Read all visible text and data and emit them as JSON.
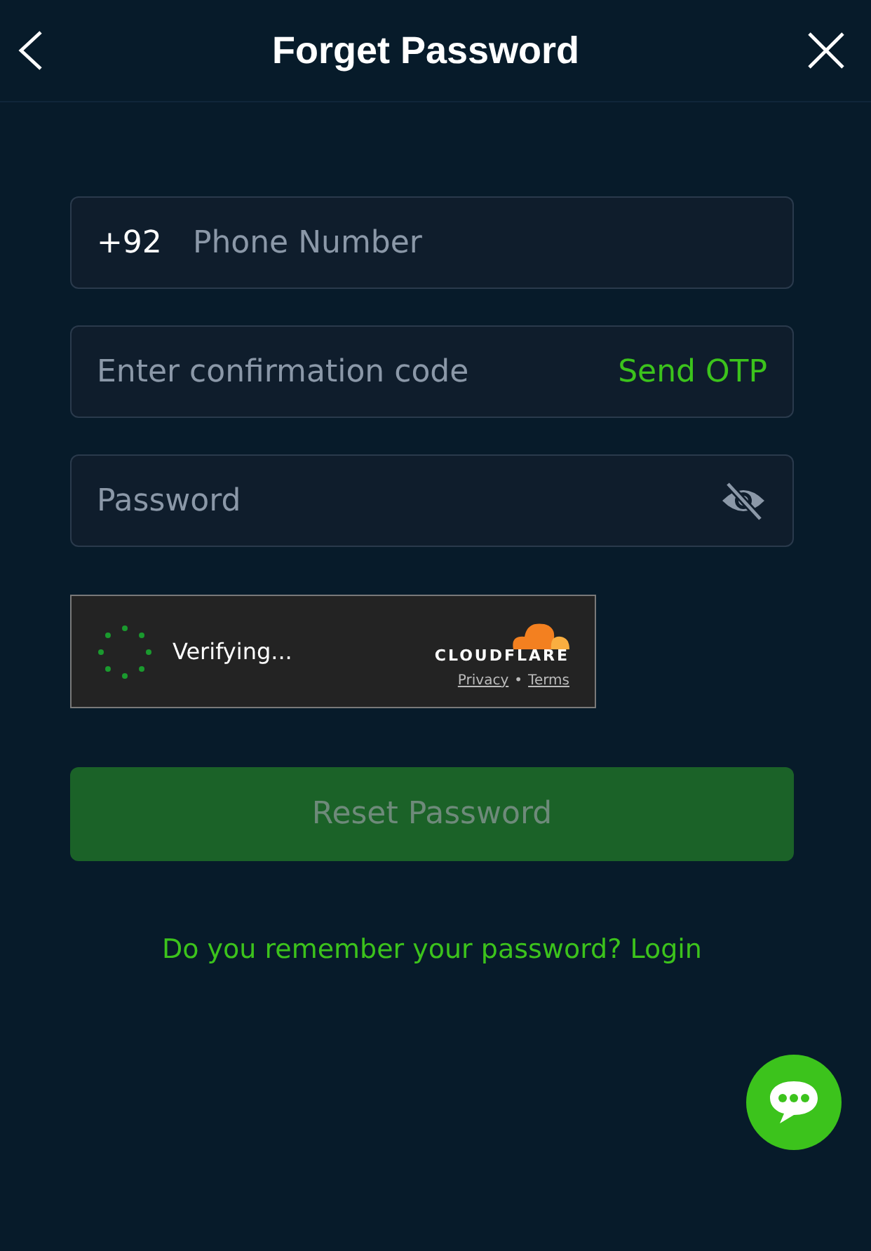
{
  "header": {
    "title": "Forget Password"
  },
  "phone": {
    "prefix": "+92",
    "placeholder": "Phone Number"
  },
  "code": {
    "placeholder": "Enter confirmation code",
    "action": "Send OTP"
  },
  "password": {
    "placeholder": "Password"
  },
  "captcha": {
    "status": "Verifying...",
    "brand": "CLOUDFLARE",
    "links": [
      "Privacy",
      "Terms"
    ],
    "separator": "•"
  },
  "reset_button": {
    "label": "Reset Password",
    "disabled": true
  },
  "footer": {
    "prompt": "Do you remember your password?",
    "link": "Login"
  }
}
